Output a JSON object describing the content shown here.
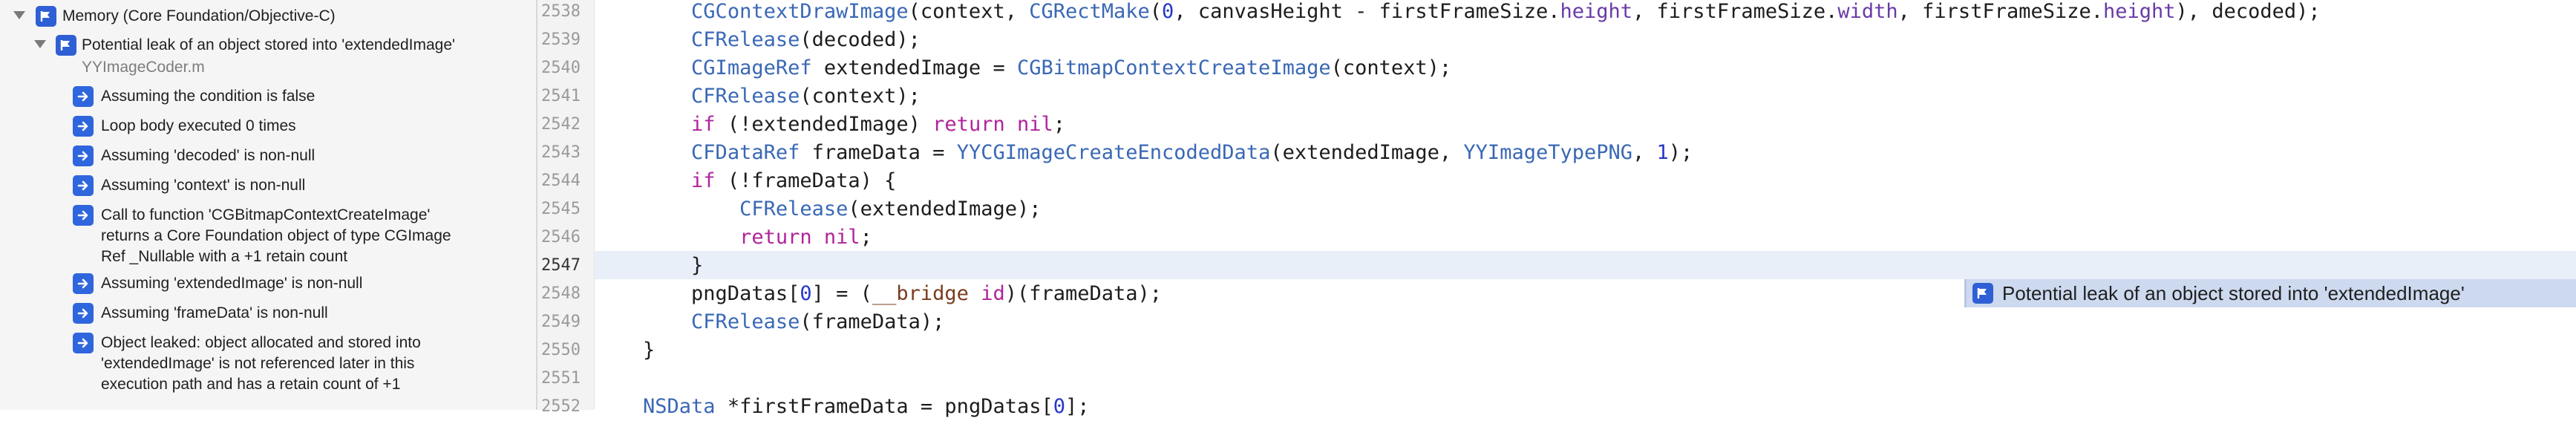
{
  "navigator": {
    "group_title": "Memory (Core Foundation/Objective-C)",
    "issue_title": "Potential leak of an object stored into 'extendedImage'",
    "issue_file": "YYImageCoder.m",
    "steps": [
      {
        "lines": [
          "Assuming the condition is false"
        ]
      },
      {
        "lines": [
          "Loop body executed 0 times"
        ]
      },
      {
        "lines": [
          "Assuming 'decoded' is non-null"
        ]
      },
      {
        "lines": [
          "Assuming 'context' is non-null"
        ]
      },
      {
        "lines": [
          "Call to function 'CGBitmapContextCreateImage'",
          "returns a Core Foundation object of type CGImage",
          "Ref _Nullable with a +1 retain count"
        ]
      },
      {
        "lines": [
          "Assuming 'extendedImage' is non-null"
        ]
      },
      {
        "lines": [
          "Assuming 'frameData' is non-null"
        ]
      },
      {
        "lines": [
          "Object leaked: object allocated and stored into",
          "'extendedImage' is not referenced later in this",
          "execution path and has a retain count of +1"
        ]
      }
    ]
  },
  "editor": {
    "line_numbers": [
      "2538",
      "2539",
      "2540",
      "2541",
      "2542",
      "2543",
      "2544",
      "2545",
      "2546",
      "2547",
      "2548",
      "2549",
      "2550",
      "2551",
      "2552"
    ],
    "current_line": "2547",
    "code": [
      [
        {
          "t": "        "
        },
        {
          "t": "CGContextDrawImage",
          "c": "fn"
        },
        {
          "t": "(context, "
        },
        {
          "t": "CGRectMake",
          "c": "fn"
        },
        {
          "t": "("
        },
        {
          "t": "0",
          "c": "num"
        },
        {
          "t": ", canvasHeight - firstFrameSize."
        },
        {
          "t": "height",
          "c": "prop"
        },
        {
          "t": ", firstFrameSize."
        },
        {
          "t": "width",
          "c": "prop"
        },
        {
          "t": ", firstFrameSize."
        },
        {
          "t": "height",
          "c": "prop"
        },
        {
          "t": "), decoded);"
        }
      ],
      [
        {
          "t": "        "
        },
        {
          "t": "CFRelease",
          "c": "fn"
        },
        {
          "t": "(decoded);"
        }
      ],
      [
        {
          "t": "        "
        },
        {
          "t": "CGImageRef",
          "c": "ty"
        },
        {
          "t": " extendedImage = "
        },
        {
          "t": "CGBitmapContextCreateImage",
          "c": "fn"
        },
        {
          "t": "(context);"
        }
      ],
      [
        {
          "t": "        "
        },
        {
          "t": "CFRelease",
          "c": "fn"
        },
        {
          "t": "(context);"
        }
      ],
      [
        {
          "t": "        "
        },
        {
          "t": "if",
          "c": "kw"
        },
        {
          "t": " (!extendedImage) "
        },
        {
          "t": "return",
          "c": "kw"
        },
        {
          "t": " "
        },
        {
          "t": "nil",
          "c": "kw"
        },
        {
          "t": ";"
        }
      ],
      [
        {
          "t": "        "
        },
        {
          "t": "CFDataRef",
          "c": "ty"
        },
        {
          "t": " frameData = "
        },
        {
          "t": "YYCGImageCreateEncodedData",
          "c": "fn"
        },
        {
          "t": "(extendedImage, "
        },
        {
          "t": "YYImageTypePNG",
          "c": "ty"
        },
        {
          "t": ", "
        },
        {
          "t": "1",
          "c": "num"
        },
        {
          "t": ");"
        }
      ],
      [
        {
          "t": "        "
        },
        {
          "t": "if",
          "c": "kw"
        },
        {
          "t": " (!frameData) {"
        }
      ],
      [
        {
          "t": "            "
        },
        {
          "t": "CFRelease",
          "c": "fn"
        },
        {
          "t": "(extendedImage);"
        }
      ],
      [
        {
          "t": "            "
        },
        {
          "t": "return",
          "c": "kw"
        },
        {
          "t": " "
        },
        {
          "t": "nil",
          "c": "kw"
        },
        {
          "t": ";"
        }
      ],
      [
        {
          "t": "        }"
        }
      ],
      [
        {
          "t": "        pngDatas["
        },
        {
          "t": "0",
          "c": "num"
        },
        {
          "t": "] = ("
        },
        {
          "t": "__bridge",
          "c": "mac"
        },
        {
          "t": " "
        },
        {
          "t": "id",
          "c": "kw"
        },
        {
          "t": ")(frameData);"
        }
      ],
      [
        {
          "t": "        "
        },
        {
          "t": "CFRelease",
          "c": "fn"
        },
        {
          "t": "(frameData);"
        }
      ],
      [
        {
          "t": "    }"
        }
      ],
      [
        {
          "t": ""
        }
      ],
      [
        {
          "t": "    "
        },
        {
          "t": "NSData",
          "c": "ty"
        },
        {
          "t": " *firstFrameData = pngDatas["
        },
        {
          "t": "0",
          "c": "num"
        },
        {
          "t": "];"
        }
      ]
    ]
  },
  "inline_issue": {
    "message": "Potential leak of an object stored into 'extendedImage'",
    "line": "2548"
  },
  "colors": {
    "badge": "#2f5fd4",
    "current_line_highlight": "#e9eff8",
    "issue_banner": "#cdd9ef"
  },
  "icons": {
    "analyzer_badge": "analyzer-issue-icon",
    "step_arrow": "step-arrow-icon",
    "disclosure": "disclosure-triangle-icon"
  }
}
